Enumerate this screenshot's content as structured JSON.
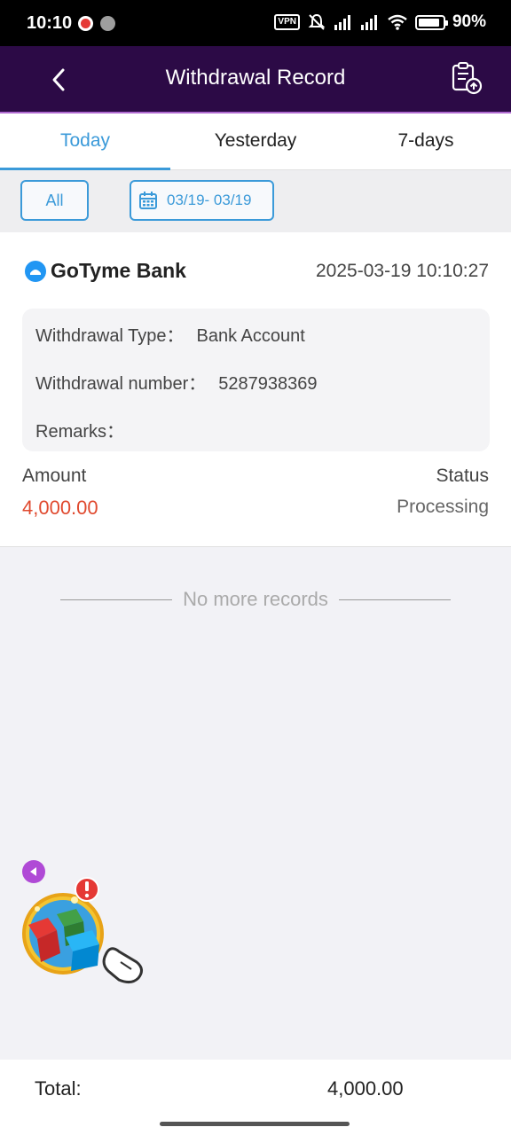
{
  "status_bar": {
    "time": "10:10",
    "vpn": "VPN",
    "battery": "90%"
  },
  "header": {
    "title": "Withdrawal Record"
  },
  "tabs": [
    {
      "label": "Today",
      "active": true
    },
    {
      "label": "Yesterday",
      "active": false
    },
    {
      "label": "7-days",
      "active": false
    }
  ],
  "filters": {
    "all_label": "All",
    "date_range": "03/19- 03/19"
  },
  "record": {
    "bank": "GoTyme Bank",
    "datetime": "2025-03-19 10:10:27",
    "type_label": "Withdrawal Type：",
    "type_value": "Bank Account",
    "number_label": "Withdrawal number：",
    "number_value": "5287938369",
    "remarks_label": "Remarks：",
    "remarks_value": "",
    "amount_label": "Amount",
    "amount_value": "4,000.00",
    "status_label": "Status",
    "status_value": "Processing"
  },
  "list_end": "No more records",
  "footer": {
    "total_label": "Total:",
    "total_value": "4,000.00"
  },
  "colors": {
    "accent": "#3b9ad9",
    "header_bg": "#2c0a46",
    "amount": "#e04a2f"
  }
}
